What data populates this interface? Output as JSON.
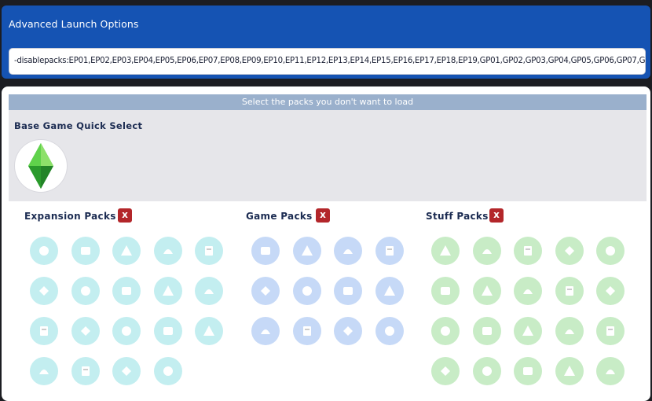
{
  "launch_options": {
    "title": "Advanced Launch Options",
    "value": "-disablepacks:EP01,EP02,EP03,EP04,EP05,EP06,EP07,EP08,EP09,EP10,EP11,EP12,EP13,EP14,EP15,EP16,EP17,EP18,EP19,GP01,GP02,GP03,GP04,GP05,GP06,GP07,GP"
  },
  "packs_panel": {
    "header": "Select the packs you don't want to load",
    "base_game": {
      "title": "Base Game Quick Select",
      "icon": "plumbob-icon"
    }
  },
  "groups": [
    {
      "id": "ep",
      "title": "Expansion Packs",
      "clear_label": "x",
      "color": "#c3eef0",
      "icons": [
        "briefcase-icon",
        "family-icon",
        "city-icon",
        "paw-icon",
        "weather-icon",
        "director-chair-icon",
        "island-icon",
        "graduation-cap-icon",
        "lightbulb-icon",
        "mountain-icon",
        "cottage-icon",
        "wave-icon",
        "home-heart-icon",
        "horseshoe-icon",
        "apartment-icon",
        "heart-flower-icon",
        "raven-icon",
        "card-icon",
        "wheat-icon"
      ]
    },
    {
      "id": "gp",
      "title": "Game Packs",
      "clear_label": "x",
      "color": "#c6d9f7",
      "icons": [
        "campfire-icon",
        "lotus-icon",
        "utensils-icon",
        "fangs-icon",
        "people-icon",
        "robot-icon",
        "tower-icon",
        "book-icon",
        "palette-icon",
        "house-icon",
        "portal-icon",
        "wolf-icon"
      ]
    },
    {
      "id": "sp",
      "title": "Stuff Packs",
      "clear_label": "x",
      "color": "#c8ecc6",
      "icons": [
        "diamond-icon",
        "bathtub-icon",
        "ice-cream-icon",
        "pumpkin-icon",
        "gift-icon",
        "rose-icon",
        "pets-icon",
        "drink-icon",
        "tuxedo-icon",
        "bowling-icon",
        "sneaker-icon",
        "laundry-icon",
        "basket-icon",
        "teddy-icon",
        "letter-m-icon",
        "home-icon",
        "picnic-basket-icon",
        "leaf-drop-icon",
        "spoon-icon",
        "pendant-icon"
      ]
    }
  ]
}
